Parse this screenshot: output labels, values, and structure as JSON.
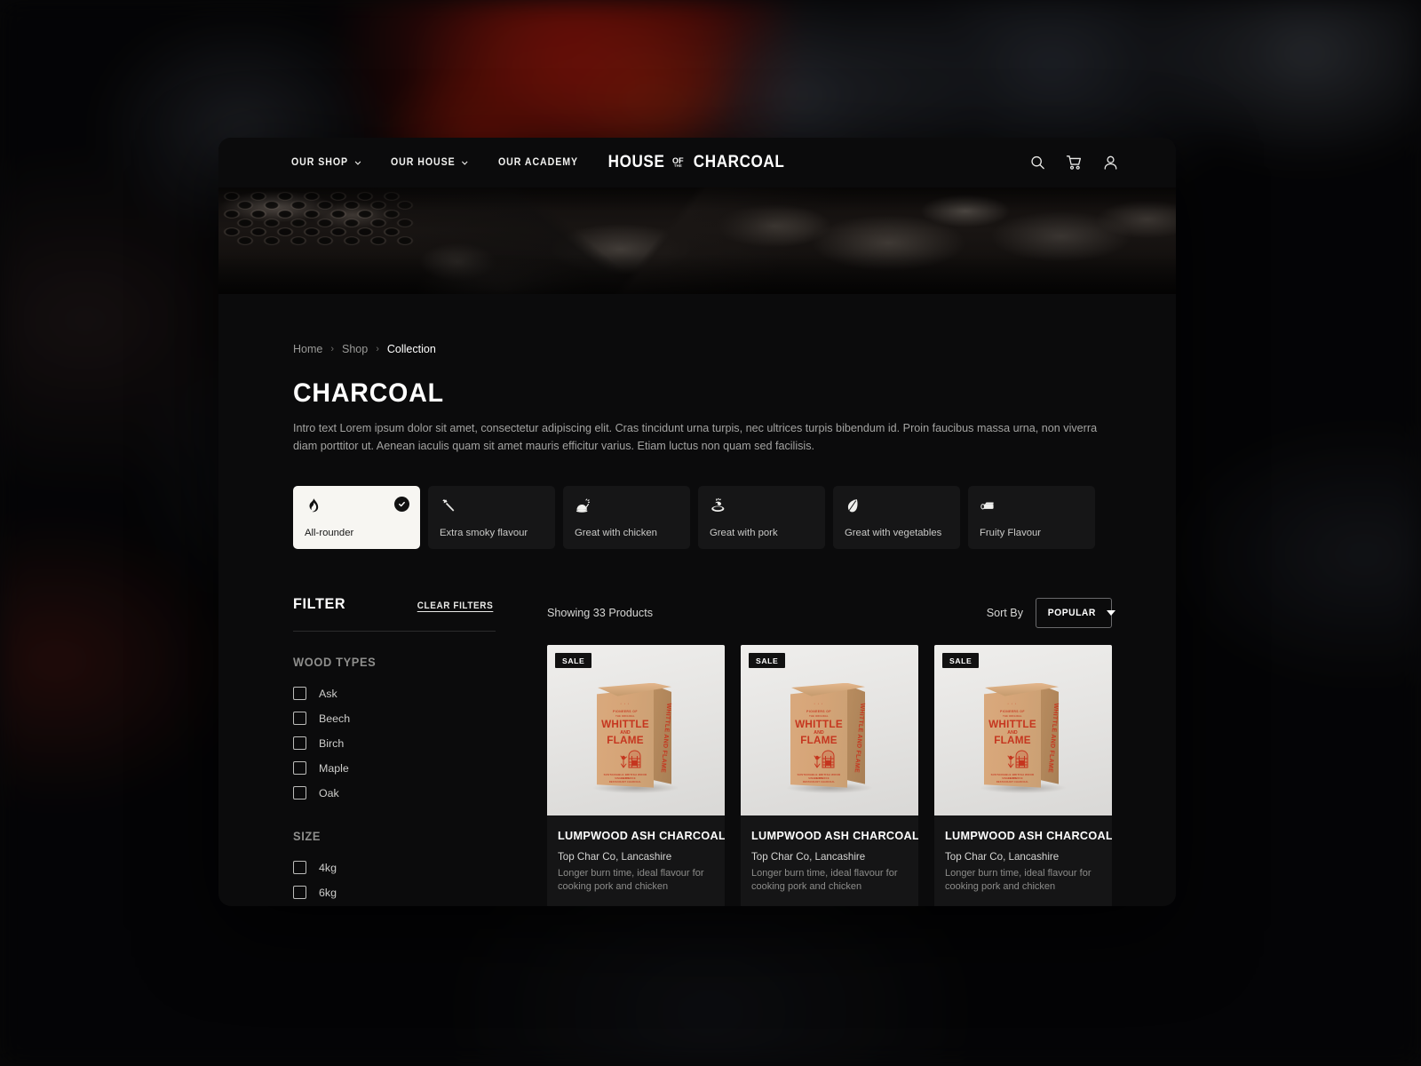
{
  "nav": {
    "links": [
      {
        "label": "OUR SHOP",
        "has_chevron": true,
        "icon": "chevron-down-icon"
      },
      {
        "label": "OUR HOUSE",
        "has_chevron": true,
        "icon": "chevron-down-icon"
      },
      {
        "label": "OUR ACADEMY",
        "has_chevron": false,
        "icon": ""
      }
    ],
    "logo": {
      "word1": "HOUSE",
      "of_top": "OF",
      "of_bottom": "THE",
      "word2": "CHARCOAL"
    },
    "icons": [
      {
        "name": "search-icon"
      },
      {
        "name": "cart-icon"
      },
      {
        "name": "account-icon"
      }
    ]
  },
  "breadcrumb": {
    "items": [
      {
        "label": "Home",
        "active": false
      },
      {
        "label": "Shop",
        "active": false
      },
      {
        "label": "Collection",
        "active": true
      }
    ],
    "separator": "›"
  },
  "header": {
    "title": "CHARCOAL",
    "intro": "Intro text Lorem ipsum dolor sit amet, consectetur adipiscing elit. Cras tincidunt urna turpis, nec ultrices turpis bibendum id. Proin faucibus massa urna, non viverra diam porttitor ut. Aenean iaculis quam sit amet mauris efficitur varius. Etiam luctus non quam sed facilisis."
  },
  "flavours": [
    {
      "label": "All-rounder",
      "icon": "flame-icon",
      "selected": true
    },
    {
      "label": "Extra smoky flavour",
      "icon": "torch-icon",
      "selected": false
    },
    {
      "label": "Great with chicken",
      "icon": "chicken-icon",
      "selected": false
    },
    {
      "label": "Great with pork",
      "icon": "pork-icon",
      "selected": false
    },
    {
      "label": "Great with vegetables",
      "icon": "leaf-icon",
      "selected": false
    },
    {
      "label": "Fruity Flavour",
      "icon": "log-icon",
      "selected": false
    }
  ],
  "filter": {
    "title": "FILTER",
    "clear_label": "CLEAR FILTERS",
    "groups": [
      {
        "title": "WOOD TYPES",
        "options": [
          {
            "label": "Ask",
            "checked": false
          },
          {
            "label": "Beech",
            "checked": false
          },
          {
            "label": "Birch",
            "checked": false
          },
          {
            "label": "Maple",
            "checked": false
          },
          {
            "label": "Oak",
            "checked": false
          }
        ]
      },
      {
        "title": "SIZE",
        "options": [
          {
            "label": "4kg",
            "checked": false
          },
          {
            "label": "6kg",
            "checked": false
          }
        ]
      }
    ]
  },
  "results": {
    "showing": "Showing 33 Products",
    "sort_label": "Sort By",
    "sort_value": "POPULAR",
    "sort_options": [
      "POPULAR"
    ]
  },
  "products": [
    {
      "badge": "SALE",
      "name": "LUMPWOOD ASH CHARCOAL",
      "vendor": "Top Char Co, Lancashire",
      "description": "Longer burn time, ideal flavour for cooking pork and chicken",
      "bag": {
        "top_line": "•  •  •",
        "small1": "PIONEERS OF",
        "small2": "THE ORIGINAL",
        "word1": "WHITTLE",
        "and": "AND",
        "word2": "FLAME",
        "bottom1": "SUSTAINABLE BRITISH WOOD CHIPS",
        "bottom2": "SINGLE SOURCE",
        "bottom3": "RESTAURANT CHARCOAL",
        "spine": "WHITTLE AND FLAME"
      }
    },
    {
      "badge": "SALE",
      "name": "LUMPWOOD ASH CHARCOAL",
      "vendor": "Top Char Co, Lancashire",
      "description": "Longer burn time, ideal flavour for cooking pork and chicken",
      "bag": {
        "top_line": "•  •  •",
        "small1": "PIONEERS OF",
        "small2": "THE ORIGINAL",
        "word1": "WHITTLE",
        "and": "AND",
        "word2": "FLAME",
        "bottom1": "SUSTAINABLE BRITISH WOOD CHIPS",
        "bottom2": "SINGLE SOURCE",
        "bottom3": "RESTAURANT CHARCOAL",
        "spine": "WHITTLE AND FLAME"
      }
    },
    {
      "badge": "SALE",
      "name": "LUMPWOOD ASH CHARCOAL",
      "vendor": "Top Char Co, Lancashire",
      "description": "Longer burn time, ideal flavour for cooking pork and chicken",
      "bag": {
        "top_line": "•  •  •",
        "small1": "PIONEERS OF",
        "small2": "THE ORIGINAL",
        "word1": "WHITTLE",
        "and": "AND",
        "word2": "FLAME",
        "bottom1": "SUSTAINABLE BRITISH WOOD CHIPS",
        "bottom2": "SINGLE SOURCE",
        "bottom3": "RESTAURANT CHARCOAL",
        "spine": "WHITTLE AND FLAME"
      }
    }
  ],
  "colors": {
    "page_bg": "#0b0b0c",
    "card_bg": "#161617",
    "selected_card_bg": "#f7f6f2",
    "text_primary": "#ffffff",
    "text_muted": "#8e8e8c",
    "brand_red": "#c5361f",
    "bag_kraft": "#d6a578"
  }
}
